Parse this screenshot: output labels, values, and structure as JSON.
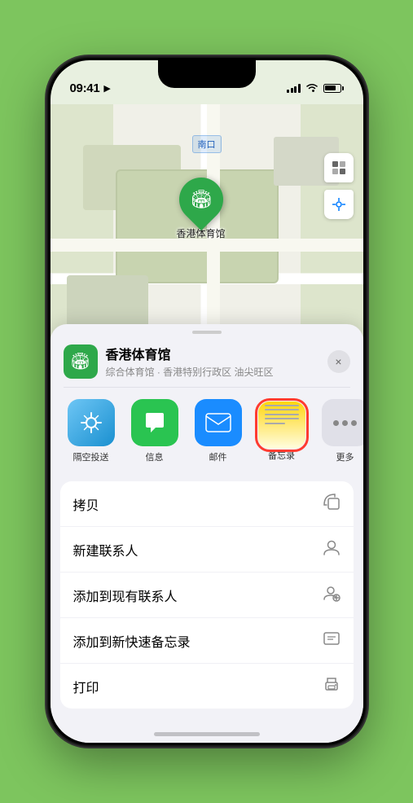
{
  "status_bar": {
    "time": "09:41",
    "location_arrow": "▶"
  },
  "map": {
    "label": "南口",
    "venue_name": "香港体育馆",
    "venue_subtitle": "综合体育馆 · 香港特别行政区 油尖旺区"
  },
  "share_row": {
    "items": [
      {
        "id": "airdrop",
        "label": "隔空投送",
        "icon": "📡"
      },
      {
        "id": "messages",
        "label": "信息",
        "icon": "💬"
      },
      {
        "id": "mail",
        "label": "邮件",
        "icon": "✉"
      },
      {
        "id": "notes",
        "label": "备忘录",
        "icon": "📝"
      },
      {
        "id": "more",
        "label": "更多",
        "icon": "..."
      }
    ]
  },
  "actions": [
    {
      "id": "copy",
      "label": "拷贝",
      "icon": "⧉"
    },
    {
      "id": "add-contact",
      "label": "新建联系人",
      "icon": "👤"
    },
    {
      "id": "add-existing",
      "label": "添加到现有联系人",
      "icon": "👤+"
    },
    {
      "id": "add-quick-note",
      "label": "添加到新快速备忘录",
      "icon": "🗒"
    },
    {
      "id": "print",
      "label": "打印",
      "icon": "🖨"
    }
  ],
  "close_btn": "×"
}
